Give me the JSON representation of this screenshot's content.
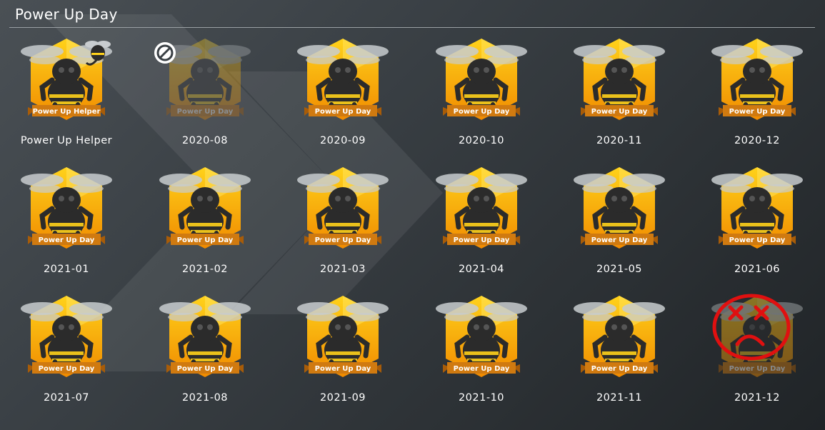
{
  "page": {
    "title": "Power Up Day"
  },
  "colors": {
    "hex_top": "#ffd21a",
    "hex_bottom": "#f08a00",
    "ribbon": "#d07a10",
    "bee_body": "#2b2b2b",
    "wing": "#c8cccf",
    "missed_marker": "#e01010"
  },
  "badges": [
    {
      "label": "Power Up Helper",
      "ribbon": "Power Up Helper",
      "state": "earned"
    },
    {
      "label": "2020-08",
      "ribbon": "Power Up Day",
      "state": "missed"
    },
    {
      "label": "2020-09",
      "ribbon": "Power Up Day",
      "state": "earned"
    },
    {
      "label": "2020-10",
      "ribbon": "Power Up Day",
      "state": "earned"
    },
    {
      "label": "2020-11",
      "ribbon": "Power Up Day",
      "state": "earned"
    },
    {
      "label": "2020-12",
      "ribbon": "Power Up Day",
      "state": "earned"
    },
    {
      "label": "2021-01",
      "ribbon": "Power Up Day",
      "state": "earned"
    },
    {
      "label": "2021-02",
      "ribbon": "Power Up Day",
      "state": "earned"
    },
    {
      "label": "2021-03",
      "ribbon": "Power Up Day",
      "state": "earned"
    },
    {
      "label": "2021-04",
      "ribbon": "Power Up Day",
      "state": "earned"
    },
    {
      "label": "2021-05",
      "ribbon": "Power Up Day",
      "state": "earned"
    },
    {
      "label": "2021-06",
      "ribbon": "Power Up Day",
      "state": "earned"
    },
    {
      "label": "2021-07",
      "ribbon": "Power Up Day",
      "state": "earned"
    },
    {
      "label": "2021-08",
      "ribbon": "Power Up Day",
      "state": "earned"
    },
    {
      "label": "2021-09",
      "ribbon": "Power Up Day",
      "state": "earned"
    },
    {
      "label": "2021-10",
      "ribbon": "Power Up Day",
      "state": "earned"
    },
    {
      "label": "2021-11",
      "ribbon": "Power Up Day",
      "state": "earned"
    },
    {
      "label": "2021-12",
      "ribbon": "Power Up Day",
      "state": "missed-marked"
    }
  ]
}
